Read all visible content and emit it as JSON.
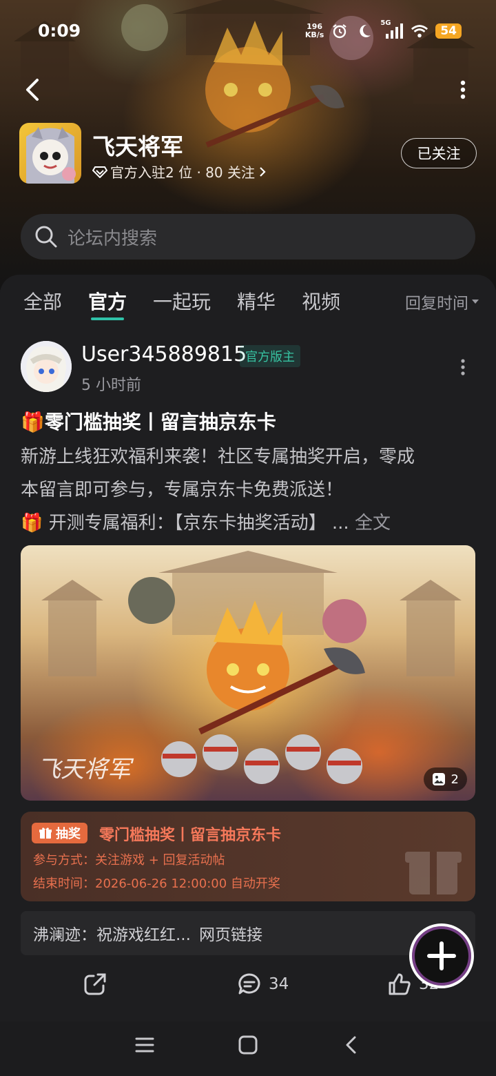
{
  "status_bar": {
    "time": "0:09",
    "net_speed_value": "196",
    "net_speed_unit": "KB/s",
    "signal_label": "5G",
    "battery": "54"
  },
  "header": {
    "game_name": "飞天将军",
    "meta_text": "官方入驻2 位 · 80 关注",
    "follow_label": "已关注"
  },
  "search": {
    "placeholder": "论坛内搜索"
  },
  "tabs": [
    {
      "label": "全部",
      "active": false
    },
    {
      "label": "官方",
      "active": true
    },
    {
      "label": "一起玩",
      "active": false
    },
    {
      "label": "精华",
      "active": false
    },
    {
      "label": "视频",
      "active": false
    }
  ],
  "sort_label": "回复时间",
  "post": {
    "username": "User345889815",
    "badge": "官方版主",
    "time": "5 小时前",
    "title": "🎁零门槛抽奖丨留言抽京东卡",
    "body_line1": "新游上线狂欢福利来袭！社区专属抽奖开启，零成",
    "body_line2": "本留言即可参与，专属京东卡免费派送！",
    "body_line3": "🎁 开测专属福利：【京东卡抽奖活动】 ... ",
    "full_text_label": "全文",
    "image_count": "2",
    "image_watermark": "飞天将军"
  },
  "lottery": {
    "tag": "抽奖",
    "title": "零门槛抽奖丨留言抽京东卡",
    "join_method": "参与方式：关注游戏 + 回复活动帖",
    "end_time": "结束时间：2026-06-26 12:00:00 自动开奖"
  },
  "comment_preview": {
    "text": "沸澜迹：祝游戏红红...",
    "link_label": "网页链接"
  },
  "actions": {
    "comment_count": "34",
    "like_count": "32"
  },
  "colors": {
    "accent": "#2fc2a8",
    "lottery_text": "#f5785a",
    "lottery_tag": "#e56a3e",
    "battery": "#f5a623"
  }
}
